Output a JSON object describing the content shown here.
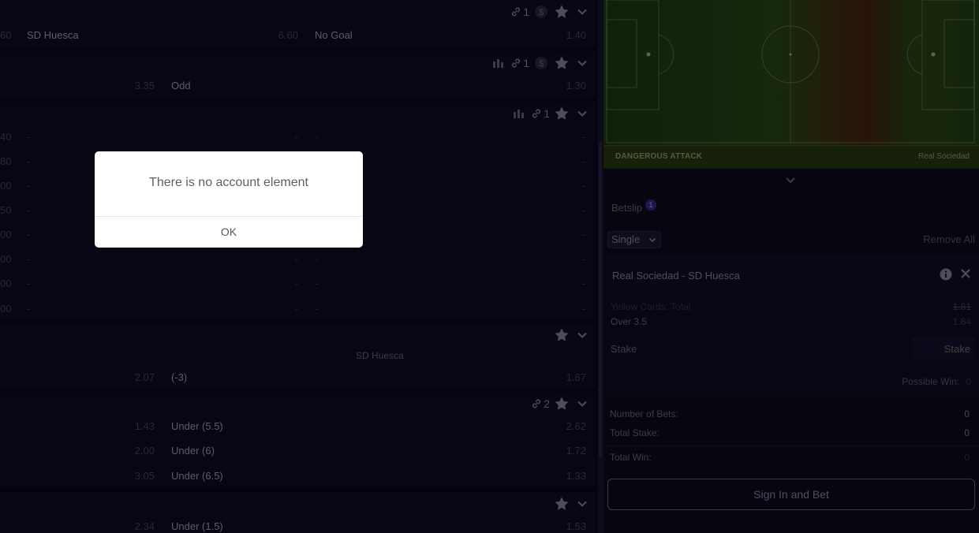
{
  "markets": {
    "block1": {
      "link_count": "1",
      "row": {
        "odd0": "60",
        "name1": "SD Huesca",
        "odd1": "6.60",
        "name2": "No Goal",
        "odd2": "1.40"
      }
    },
    "block2": {
      "link_count": "1",
      "row": {
        "odd1": "3.35",
        "name2": "Odd",
        "odd2": "1.30"
      }
    },
    "block3": {
      "link_count": "1",
      "dash": "-",
      "rows": [
        "40",
        "80",
        "00",
        "50",
        "00",
        "00",
        "00",
        "00"
      ]
    },
    "block4": {
      "team": "SD Huesca",
      "row": {
        "odd1": "2.07",
        "name2": "(-3)",
        "odd2": "1.67"
      }
    },
    "block5": {
      "link_count": "2",
      "rows": [
        {
          "odd1": "1.43",
          "name2": "Under (5.5)",
          "odd2": "2.62"
        },
        {
          "odd1": "2.00",
          "name2": "Under (6)",
          "odd2": "1.72"
        },
        {
          "odd1": "3.05",
          "name2": "Under (6.5)",
          "odd2": "1.33"
        }
      ]
    },
    "block6": {
      "row": {
        "odd1": "2.34",
        "name2": "Under (1.5)",
        "odd2": "1.53"
      }
    }
  },
  "pitch": {
    "event_label": "DANGEROUS ATTACK",
    "team_label": "Real Sociedad"
  },
  "betslip": {
    "title": "Betslip",
    "count": "1",
    "type_value": "Single",
    "remove_all": "Remove All",
    "event": "Real Sociedad - SD Huesca",
    "market": "Yellow Cards: Total",
    "old_odd": "1.81",
    "pick": "Over 3.5",
    "new_odd": "1.84",
    "stake_label": "Stake",
    "stake_placeholder": "Stake",
    "possible_win_label": "Possible Win:",
    "possible_win_value": "0",
    "num_bets_label": "Number of Bets:",
    "num_bets_value": "0",
    "total_stake_label": "Total Stake:",
    "total_stake_value": "0",
    "total_win_label": "Total Win:",
    "total_win_value": "0",
    "signin_label": "Sign In and Bet"
  },
  "dialog": {
    "message": "There is no account element",
    "ok_label": "OK"
  },
  "icons": [
    "link-icon",
    "dollar-icon",
    "star-icon",
    "chevron-down-icon",
    "stats-icon",
    "info-icon",
    "close-icon"
  ],
  "colors": {
    "background": "#07061a",
    "panel": "#0d0b22",
    "dialog": "#ffffff",
    "pitch_green": "#2a4a17",
    "pitch_red": "#4a2410"
  }
}
